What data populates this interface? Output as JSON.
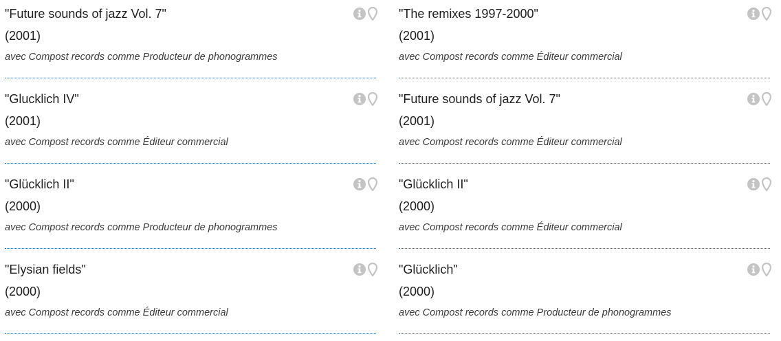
{
  "icon_color": "#c4c4c4",
  "separator_color": "#2d6aa6",
  "columns": [
    {
      "items": [
        {
          "title": "\"Future sounds of jazz Vol. 7\"",
          "year": "(2001)",
          "role": "avec Compost records comme Producteur de phonogrammes"
        },
        {
          "title": "\"Glucklich IV\"",
          "year": "(2001)",
          "role": "avec Compost records comme Éditeur commercial"
        },
        {
          "title": "\"Glücklich II\"",
          "year": "(2000)",
          "role": "avec Compost records comme Producteur de phonogrammes"
        },
        {
          "title": "\"Elysian fields\"",
          "year": "(2000)",
          "role": "avec Compost records comme Éditeur commercial"
        }
      ]
    },
    {
      "items": [
        {
          "title": "\"The remixes 1997-2000\"",
          "year": "(2001)",
          "role": "avec Compost records comme Éditeur commercial"
        },
        {
          "title": "\"Future sounds of jazz Vol. 7\"",
          "year": "(2001)",
          "role": "avec Compost records comme Éditeur commercial"
        },
        {
          "title": "\"Glücklich II\"",
          "year": "(2000)",
          "role": "avec Compost records comme Éditeur commercial"
        },
        {
          "title": "\"Glücklich\"",
          "year": "(2000)",
          "role": "avec Compost records comme Producteur de phonogrammes"
        }
      ]
    }
  ],
  "icons": [
    "info-icon",
    "map-marker-icon"
  ]
}
